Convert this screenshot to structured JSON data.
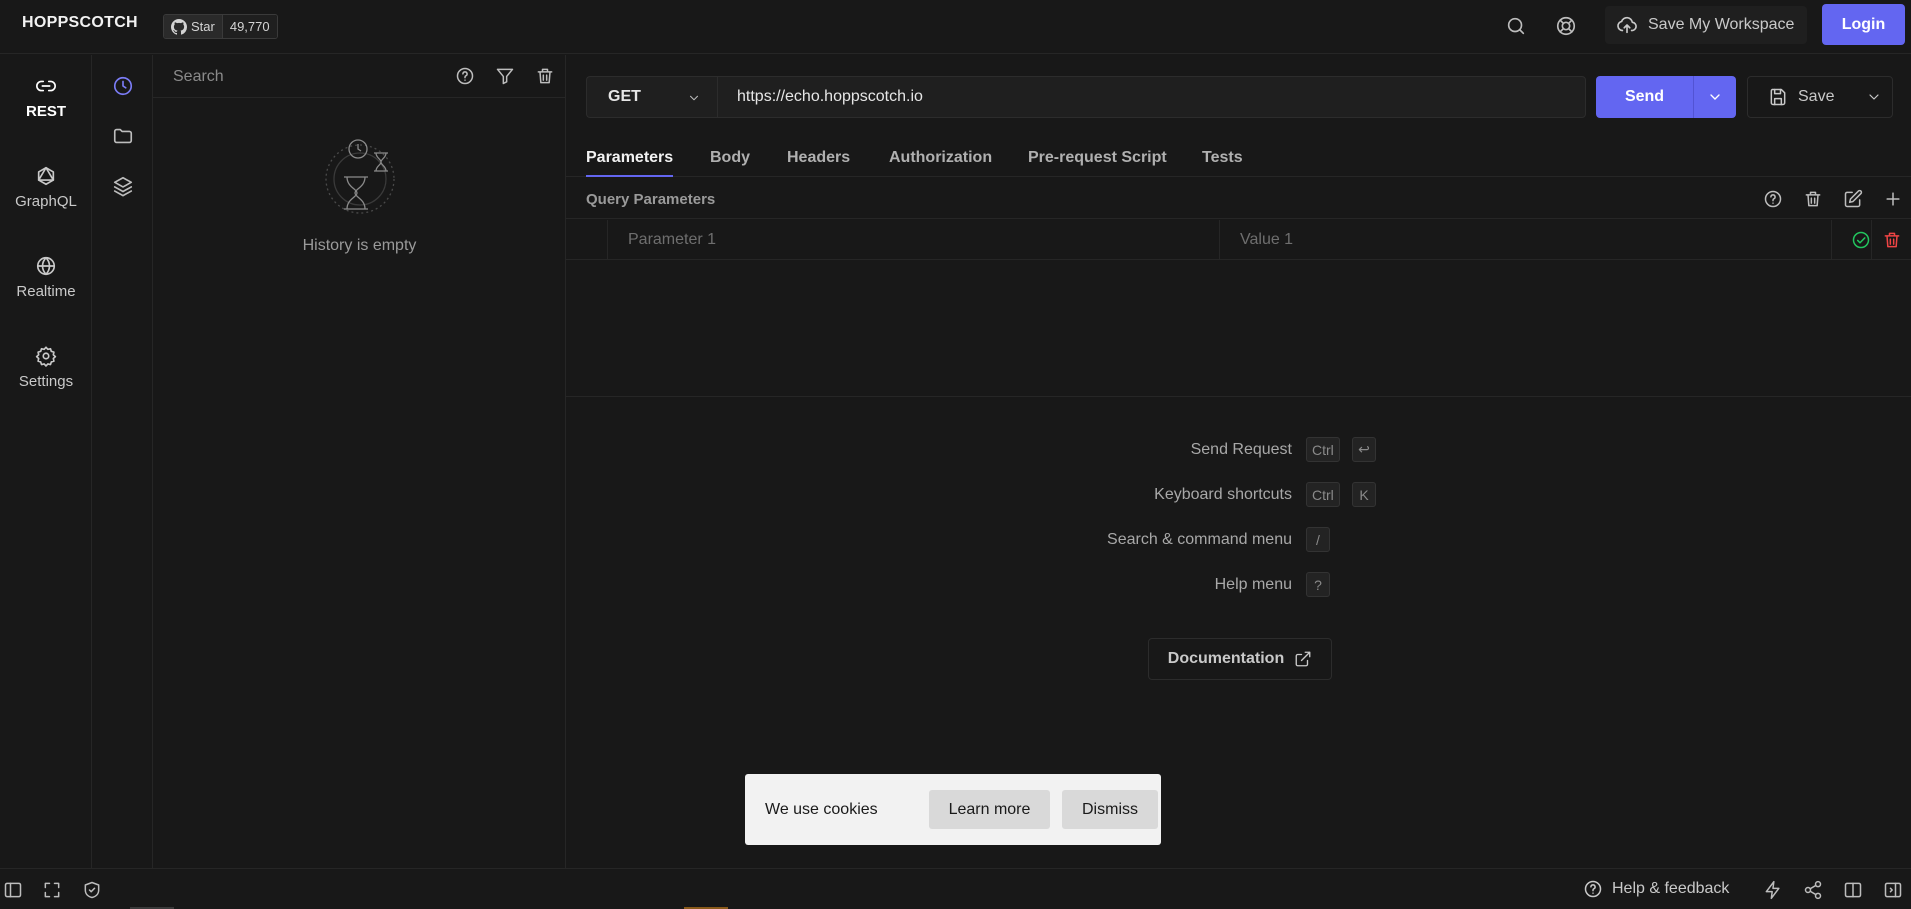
{
  "header": {
    "brand": "HOPPSCOTCH",
    "github_star_label": "Star",
    "github_star_count": "49,770",
    "save_workspace_label": "Save My Workspace",
    "login_label": "Login"
  },
  "rail": {
    "items": [
      {
        "label": "REST",
        "icon": "link-icon",
        "active": true
      },
      {
        "label": "GraphQL",
        "icon": "graphql-icon"
      },
      {
        "label": "Realtime",
        "icon": "globe-icon"
      },
      {
        "label": "Settings",
        "icon": "gear-icon"
      }
    ]
  },
  "history": {
    "search_placeholder": "Search",
    "empty_text": "History is empty"
  },
  "request": {
    "method": "GET",
    "url": "https://echo.hoppscotch.io",
    "send_label": "Send",
    "save_label": "Save",
    "tabs": [
      "Parameters",
      "Body",
      "Headers",
      "Authorization",
      "Pre-request Script",
      "Tests"
    ],
    "active_tab": "Parameters",
    "query_params_title": "Query Parameters",
    "param_placeholder": "Parameter 1",
    "value_placeholder": "Value 1"
  },
  "shortcuts": [
    {
      "label": "Send Request",
      "keys": [
        "Ctrl",
        "↩"
      ]
    },
    {
      "label": "Keyboard shortcuts",
      "keys": [
        "Ctrl",
        "K"
      ]
    },
    {
      "label": "Search & command menu",
      "keys": [
        "/"
      ]
    },
    {
      "label": "Help menu",
      "keys": [
        "?"
      ]
    }
  ],
  "documentation_label": "Documentation",
  "cookie": {
    "message": "We use cookies",
    "learn_more": "Learn more",
    "dismiss": "Dismiss"
  },
  "footer": {
    "help_label": "Help & feedback"
  },
  "colors": {
    "accent": "#6366f1",
    "background": "#181818",
    "success": "#22c55e",
    "danger": "#ef4444"
  }
}
